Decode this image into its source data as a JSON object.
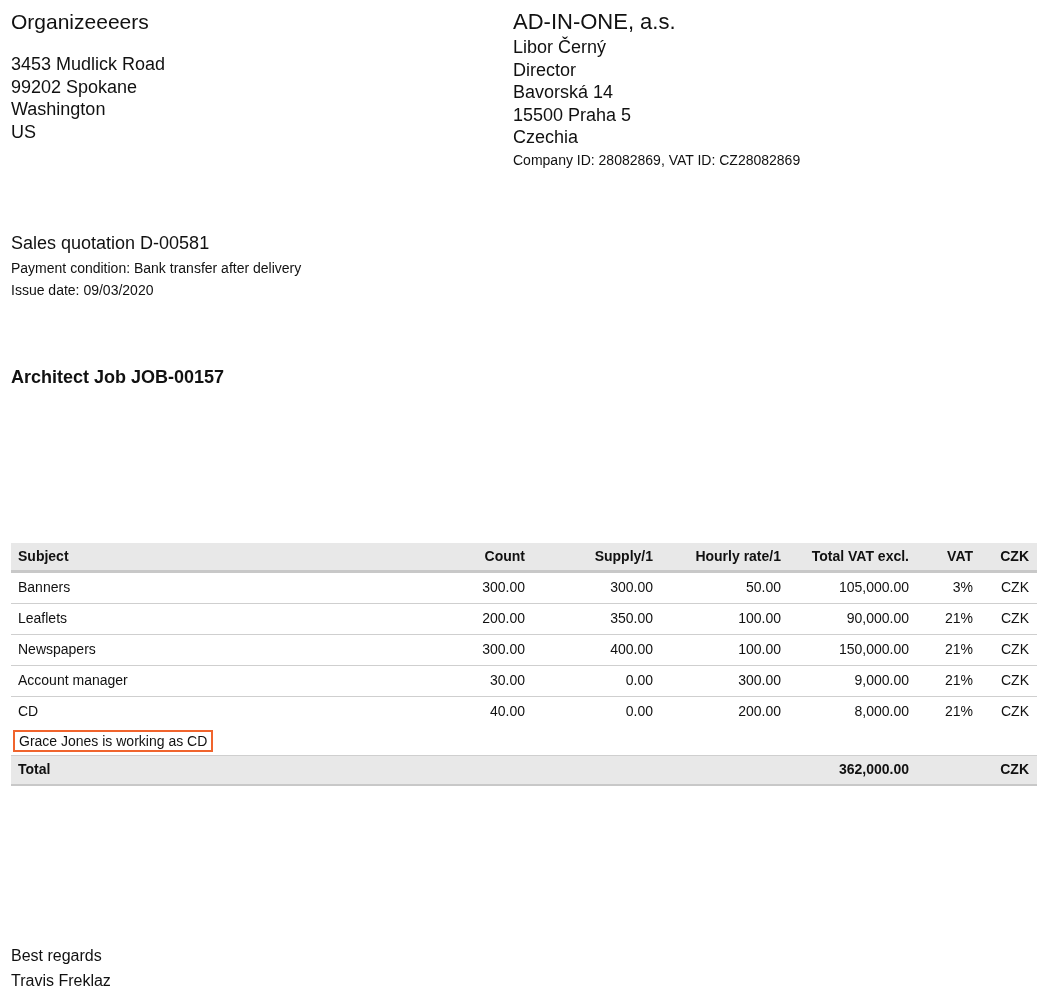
{
  "sender": {
    "name": "Organizeeeers",
    "address": [
      "3453 Mudlick Road",
      "99202 Spokane",
      "Washington",
      "US"
    ]
  },
  "recipient": {
    "company": "AD-IN-ONE, a.s.",
    "lines": [
      "Libor Černý",
      "Director",
      "Bavorská 14",
      "15500 Praha 5",
      "Czechia"
    ],
    "ids": "Company ID: 28082869, VAT ID: CZ28082869"
  },
  "quotation": {
    "title": "Sales quotation D-00581",
    "payment": "Payment condition: Bank transfer after delivery",
    "issue_date": "Issue date: 09/03/2020"
  },
  "job": "Architect Job JOB-00157",
  "table": {
    "columns": [
      "Subject",
      "Count",
      "Supply/1",
      "Hourly rate/1",
      "Total VAT excl.",
      "VAT",
      "CZK"
    ],
    "rows": [
      {
        "cells": [
          "Banners",
          "300.00",
          "300.00",
          "50.00",
          "105,000.00",
          "3%",
          "CZK"
        ]
      },
      {
        "cells": [
          "Leaflets",
          "200.00",
          "350.00",
          "100.00",
          "90,000.00",
          "21%",
          "CZK"
        ]
      },
      {
        "cells": [
          "Newspapers",
          "300.00",
          "400.00",
          "100.00",
          "150,000.00",
          "21%",
          "CZK"
        ]
      },
      {
        "cells": [
          "Account manager",
          "30.00",
          "0.00",
          "300.00",
          "9,000.00",
          "21%",
          "CZK"
        ]
      },
      {
        "cells": [
          "CD",
          "40.00",
          "0.00",
          "200.00",
          "8,000.00",
          "21%",
          "CZK"
        ],
        "note": {
          "text": "Grace Jones is working as CD",
          "highlighted": true
        }
      }
    ],
    "total": {
      "label": "Total",
      "amount": "362,000.00",
      "currency": "CZK"
    }
  },
  "closing": {
    "greeting": "Best regards",
    "signature": "Travis Freklaz"
  }
}
